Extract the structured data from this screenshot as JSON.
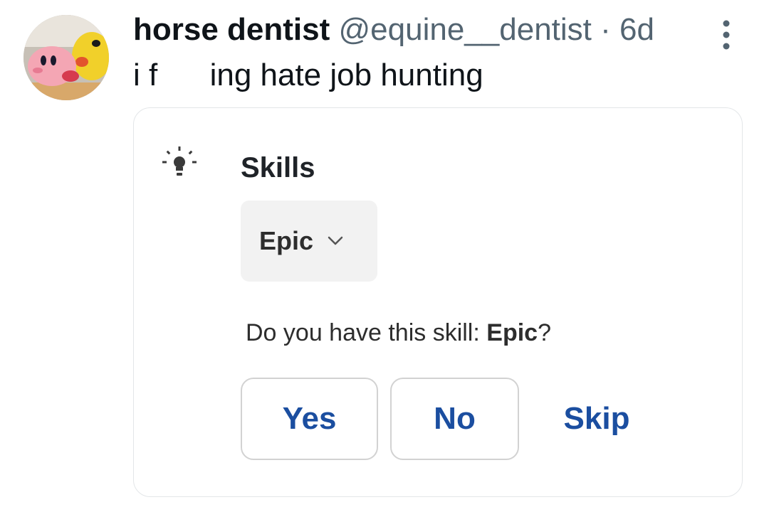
{
  "tweet": {
    "display_name": "horse dentist",
    "handle": "@equine__dentist",
    "separator": "·",
    "time": "6d",
    "text": "i f      ing hate job hunting"
  },
  "icons": {
    "more": "more-options-icon",
    "bulb": "lightbulb-icon",
    "chevron": "chevron-down-icon"
  },
  "card": {
    "title": "Skills",
    "dropdown_value": "Epic",
    "question_prefix": "Do you have this skill: ",
    "question_skill": "Epic",
    "question_suffix": "?",
    "buttons": {
      "yes": "Yes",
      "no": "No",
      "skip": "Skip"
    }
  },
  "colors": {
    "action_blue": "#1b4ea0",
    "secondary_text": "#536471",
    "dropdown_bg": "#f2f2f2"
  }
}
